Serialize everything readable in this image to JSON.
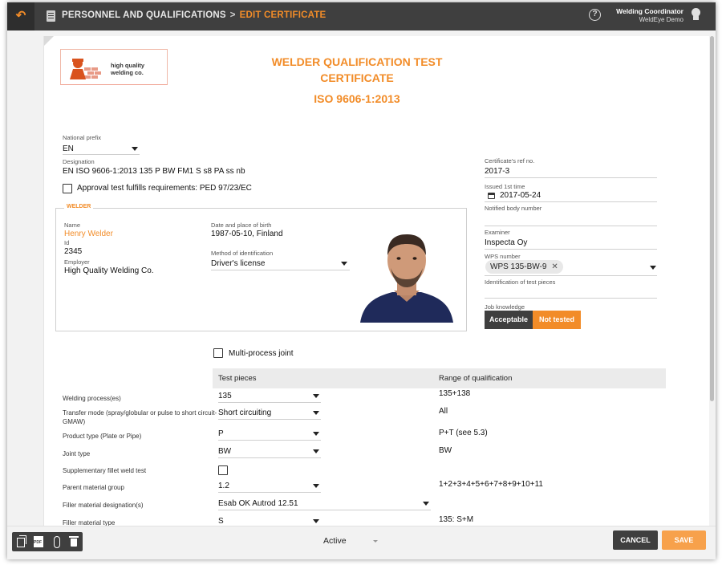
{
  "topbar": {
    "breadcrumb_section": "PERSONNEL AND QUALIFICATIONS",
    "breadcrumb_sep": ">",
    "breadcrumb_page": "EDIT CERTIFICATE",
    "user_role": "Welding Coordinator",
    "user_org": "WeldEye Demo",
    "help_symbol": "?",
    "back_symbol": "↶"
  },
  "document": {
    "logo_text": "high quality welding co.",
    "title_line1": "WELDER QUALIFICATION TEST",
    "title_line2": "CERTIFICATE",
    "standard": "ISO 9606-1:2013"
  },
  "left_fields": {
    "national_prefix_label": "National prefix",
    "national_prefix_value": "EN",
    "designation_label": "Designation",
    "designation_value": "EN ISO 9606-1:2013 135 P BW FM1 S s8 PA ss nb",
    "approval_label": "Approval test fulfills requirements: PED 97/23/EC"
  },
  "welder": {
    "legend": "WELDER",
    "name_label": "Name",
    "name_value": "Henry Welder",
    "id_label": "Id",
    "id_value": "2345",
    "employer_label": "Employer",
    "employer_value": "High Quality Welding Co.",
    "dob_label": "Date and place of birth",
    "dob_value": "1987-05-10, Finland",
    "method_label": "Method of identification",
    "method_value": "Driver's license"
  },
  "right_fields": {
    "cert_ref_label": "Certificate's ref no.",
    "cert_ref_value": "2017-3",
    "issued_label": "Issued 1st time",
    "issued_value": "2017-05-24",
    "notified_label": "Notified body number",
    "notified_value": "",
    "examiner_label": "Examiner",
    "examiner_value": "Inspecta Oy",
    "wps_label": "WPS number",
    "wps_tag": "WPS 135-BW-9",
    "wps_remove": "✕",
    "test_pieces_label": "Identification of test pieces",
    "job_knowledge_label": "Job knowledge",
    "job_option_1": "Acceptable",
    "job_option_2": "Not tested"
  },
  "table": {
    "multi_process_label": "Multi-process joint",
    "col_test_pieces": "Test pieces",
    "col_range": "Range of qualification",
    "rows": [
      {
        "label": "Welding process(es)",
        "value": "135",
        "range": "135+138"
      },
      {
        "label": "Transfer mode (spray/globular or pulse to short circuit-GMAW)",
        "value": "Short circuiting",
        "range": "All"
      },
      {
        "label": "Product type (Plate or Pipe)",
        "value": "P",
        "range": "P+T (see 5.3)"
      },
      {
        "label": "Joint type",
        "value": "BW",
        "range": "BW"
      },
      {
        "label": "Supplementary fillet weld test",
        "value": "",
        "range": ""
      },
      {
        "label": "Parent material group",
        "value": "1.2",
        "range": "1+2+3+4+5+6+7+8+9+10+11"
      },
      {
        "label": "Filler material designation(s)",
        "value": "Esab OK Autrod 12.51",
        "range": ""
      },
      {
        "label": "Filler material type",
        "value": "S",
        "range": "135: S+M"
      }
    ]
  },
  "bottombar": {
    "status_value": "Active",
    "cancel_label": "CANCEL",
    "save_label": "SAVE"
  },
  "colors": {
    "accent": "#f28c28",
    "topbar": "#3f3f3f",
    "save": "#f7a14b"
  }
}
